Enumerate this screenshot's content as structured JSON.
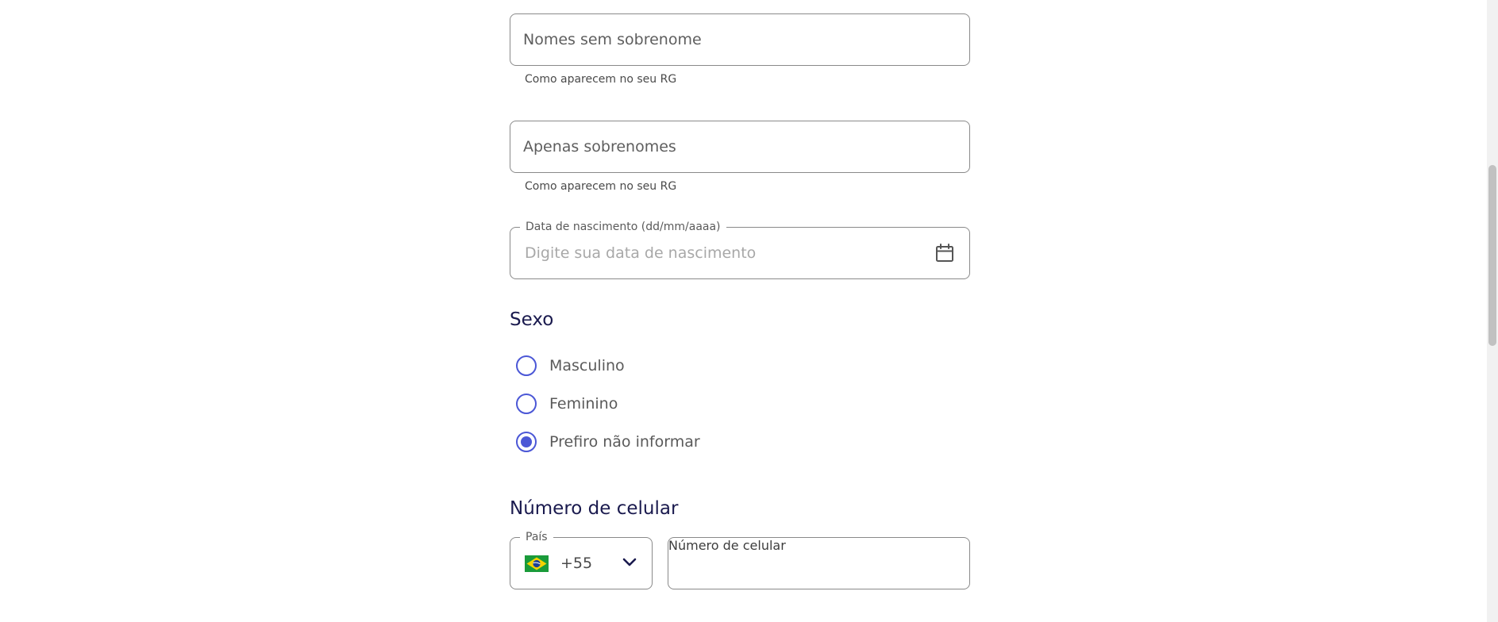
{
  "first_name": {
    "placeholder": "Nomes sem sobrenome",
    "helper": "Como aparecem no seu RG"
  },
  "last_name": {
    "placeholder": "Apenas sobrenomes",
    "helper": "Como aparecem no seu RG"
  },
  "birth_date": {
    "label": "Data de nascimento (dd/mm/aaaa)",
    "placeholder": "Digite sua data de nascimento",
    "icon": "calendar-icon"
  },
  "sex": {
    "title": "Sexo",
    "options": [
      {
        "label": "Masculino",
        "checked": false
      },
      {
        "label": "Feminino",
        "checked": false
      },
      {
        "label": "Prefiro não informar",
        "checked": true
      }
    ]
  },
  "phone": {
    "title": "Número de celular",
    "country_label": "País",
    "country_code": "+55",
    "country_flag": "brazil-flag-icon",
    "placeholder": "Número de celular"
  },
  "colors": {
    "accent": "#4b57d6",
    "title": "#1a1a4e",
    "border": "#8a8a8a"
  }
}
